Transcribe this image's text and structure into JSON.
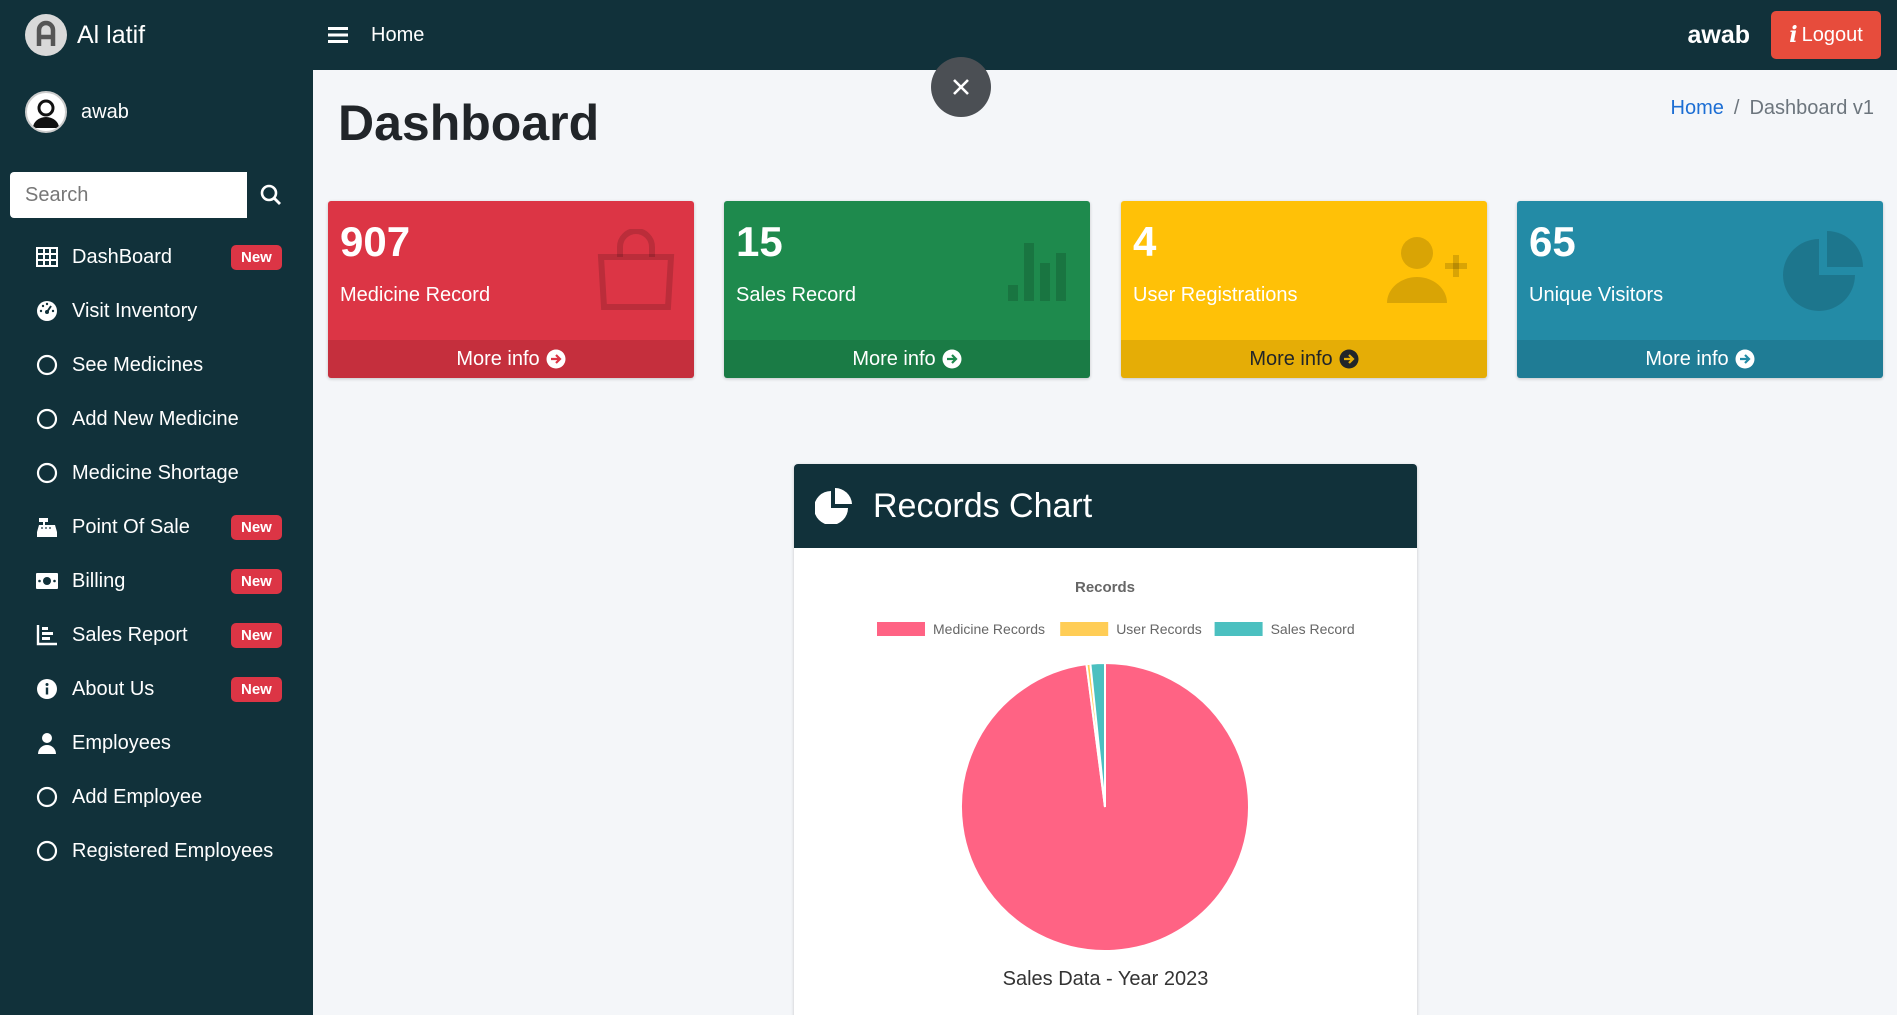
{
  "brand": {
    "name": "Al latif"
  },
  "user": {
    "name": "awab"
  },
  "search": {
    "placeholder": "Search"
  },
  "sidebar": {
    "items": [
      {
        "label": "DashBoard",
        "icon": "grid-icon",
        "badge": "New"
      },
      {
        "label": "Visit Inventory",
        "icon": "gauge-icon"
      },
      {
        "label": "See Medicines",
        "icon": "circle-icon"
      },
      {
        "label": "Add New Medicine",
        "icon": "circle-icon"
      },
      {
        "label": "Medicine Shortage",
        "icon": "circle-icon"
      },
      {
        "label": "Point Of Sale",
        "icon": "cash-register-icon",
        "badge": "New"
      },
      {
        "label": "Billing",
        "icon": "money-bill-icon",
        "badge": "New"
      },
      {
        "label": "Sales Report",
        "icon": "bar-chart-icon",
        "badge": "New"
      },
      {
        "label": "About Us",
        "icon": "info-circle-icon",
        "badge": "New"
      },
      {
        "label": "Employees",
        "icon": "user-icon"
      },
      {
        "label": "Add Employee",
        "icon": "circle-icon"
      },
      {
        "label": "Registered Employees",
        "icon": "circle-icon"
      }
    ]
  },
  "topnav": {
    "home": "Home",
    "user": "awab",
    "logout": "Logout",
    "logout_icon": "i"
  },
  "page": {
    "title": "Dashboard"
  },
  "breadcrumb": {
    "home": "Home",
    "sep": "/",
    "current": "Dashboard v1"
  },
  "boxes": [
    {
      "value": "907",
      "label": "Medicine Record",
      "more": "More info",
      "color": "#dc3545",
      "icon": "shopping-bag-icon"
    },
    {
      "value": "15",
      "label": "Sales Record",
      "more": "More info",
      "color": "#1e8a4d",
      "icon": "bar-chart-icon"
    },
    {
      "value": "4",
      "label": "User Registrations",
      "more": "More info",
      "color": "#ffc107",
      "icon": "user-plus-icon"
    },
    {
      "value": "65",
      "label": "Unique Visitors",
      "more": "More info",
      "color": "#238ba6",
      "icon": "pie-chart-icon"
    }
  ],
  "card": {
    "title": "Records Chart",
    "caption": "Sales Data - Year 2023"
  },
  "chart_data": {
    "type": "pie",
    "title": "Records",
    "labels": [
      "Medicine Records",
      "User Records",
      "Sales Record"
    ],
    "values": [
      907,
      4,
      15
    ],
    "colors": [
      "#ff6384",
      "#ffcd56",
      "#4bc0c0"
    ],
    "legend": "top"
  }
}
